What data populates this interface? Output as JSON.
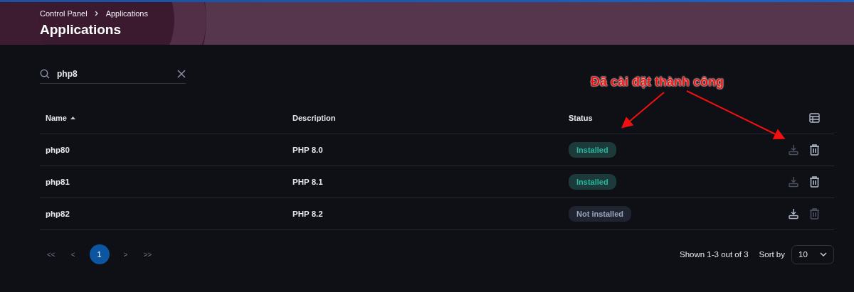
{
  "breadcrumb": [
    {
      "label": "Control Panel"
    },
    {
      "label": "Applications"
    }
  ],
  "page_title": "Applications",
  "search": {
    "value": "php8"
  },
  "table": {
    "columns": [
      {
        "label": "Name",
        "sorted": true
      },
      {
        "label": "Description",
        "sorted": false
      },
      {
        "label": "Status",
        "sorted": false
      }
    ],
    "rows": [
      {
        "name": "php80",
        "description": "PHP 8.0",
        "status": "Installed",
        "installed": true
      },
      {
        "name": "php81",
        "description": "PHP 8.1",
        "status": "Installed",
        "installed": true
      },
      {
        "name": "php82",
        "description": "PHP 8.2",
        "status": "Not installed",
        "installed": false
      }
    ]
  },
  "pagination": {
    "first": "<<",
    "prev": "<",
    "pages": [
      {
        "label": "1",
        "selected": true
      }
    ],
    "next": ">",
    "last": ">>"
  },
  "summary": "Shown 1-3 out of 3",
  "sort": {
    "label": "Sort by",
    "value": "10"
  },
  "annotation": {
    "text": "Đã cài đặt thành công"
  }
}
